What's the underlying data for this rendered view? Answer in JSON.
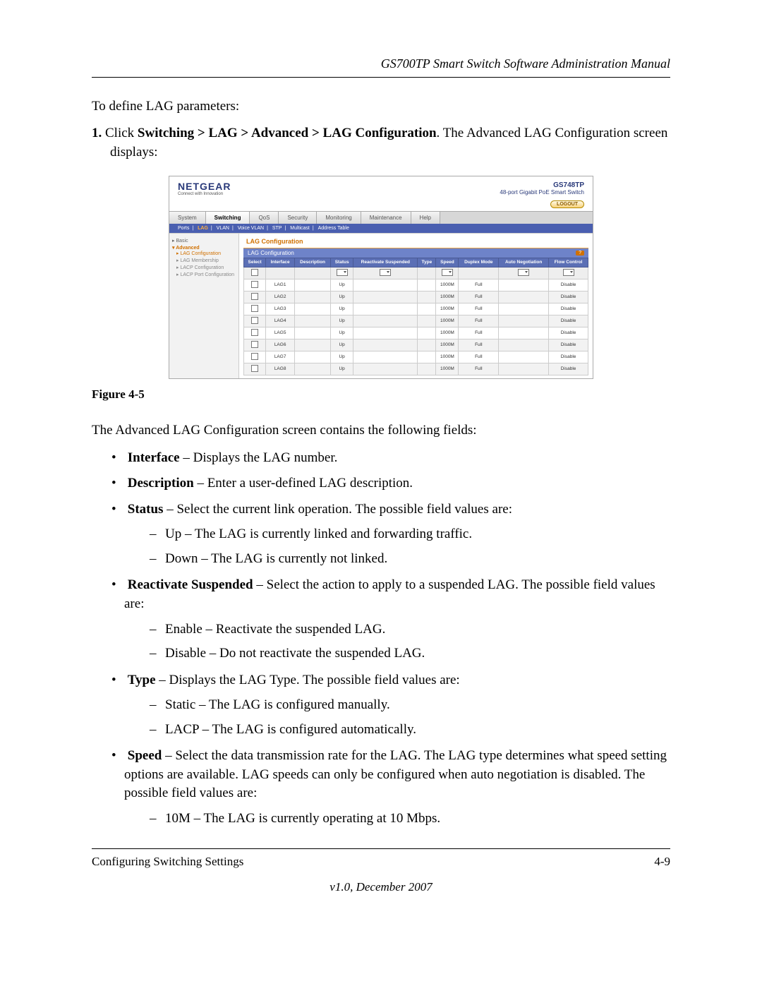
{
  "header_title": "GS700TP Smart Switch Software Administration Manual",
  "intro": "To define LAG parameters:",
  "step": {
    "num": "1.",
    "pre": "Click ",
    "path": "Switching > LAG > Advanced > LAG Configuration",
    "post": ". The Advanced LAG Configuration screen displays:"
  },
  "screenshot": {
    "logo": "NETGEAR",
    "logo_sub": "Connect with Innovation",
    "model_num": "GS748TP",
    "model_desc": "48-port Gigabit PoE Smart Switch",
    "logout": "LOGOUT",
    "tabs": [
      "System",
      "Switching",
      "QoS",
      "Security",
      "Monitoring",
      "Maintenance",
      "Help"
    ],
    "active_tab": "Switching",
    "subtabs": [
      "Ports",
      "LAG",
      "VLAN",
      "Voice VLAN",
      "STP",
      "Multicast",
      "Address Table"
    ],
    "active_subtab": "LAG",
    "side": {
      "basic": "Basic",
      "advanced": "Advanced",
      "items": [
        "LAG Configuration",
        "LAG Membership",
        "LACP Configuration",
        "LACP Port Configuration"
      ]
    },
    "panel_title": "LAG Configuration",
    "inner_title": "LAG Configuration",
    "help": "?",
    "columns": [
      "Select",
      "Interface",
      "Description",
      "Status",
      "Reactivate Suspended",
      "Type",
      "Speed",
      "Duplex Mode",
      "Auto Negotiation",
      "Flow Control"
    ],
    "rows": [
      {
        "if": "LAG1",
        "status": "Up",
        "speed": "1000M",
        "duplex": "Full",
        "flow": "Disable",
        "alt": false
      },
      {
        "if": "LAG2",
        "status": "Up",
        "speed": "1000M",
        "duplex": "Full",
        "flow": "Disable",
        "alt": true
      },
      {
        "if": "LAG3",
        "status": "Up",
        "speed": "1000M",
        "duplex": "Full",
        "flow": "Disable",
        "alt": false
      },
      {
        "if": "LAG4",
        "status": "Up",
        "speed": "1000M",
        "duplex": "Full",
        "flow": "Disable",
        "alt": true
      },
      {
        "if": "LAG5",
        "status": "Up",
        "speed": "1000M",
        "duplex": "Full",
        "flow": "Disable",
        "alt": false
      },
      {
        "if": "LAG6",
        "status": "Up",
        "speed": "1000M",
        "duplex": "Full",
        "flow": "Disable",
        "alt": true
      },
      {
        "if": "LAG7",
        "status": "Up",
        "speed": "1000M",
        "duplex": "Full",
        "flow": "Disable",
        "alt": false
      },
      {
        "if": "LAG8",
        "status": "Up",
        "speed": "1000M",
        "duplex": "Full",
        "flow": "Disable",
        "alt": true
      }
    ]
  },
  "caption": "Figure 4-5",
  "para_fields_intro": "The Advanced LAG Configuration screen contains the following fields:",
  "fields": {
    "interface": {
      "name": "Interface",
      "desc": " – Displays the LAG number."
    },
    "description": {
      "name": "Description",
      "desc": " – Enter a user-defined LAG description."
    },
    "status": {
      "name": "Status",
      "desc": " – Select the current link operation. The possible field values are:",
      "sub": [
        "Up – The LAG is currently linked and forwarding traffic.",
        "Down – The LAG is currently not linked."
      ]
    },
    "reactivate": {
      "name": "Reactivate Suspended",
      "desc": " – Select the action to apply to a suspended LAG. The possible field values are:",
      "sub": [
        "Enable – Reactivate the suspended LAG.",
        "Disable – Do not reactivate the suspended LAG."
      ]
    },
    "type": {
      "name": "Type",
      "desc": " – Displays the LAG Type. The possible field values are:",
      "sub": [
        "Static – The LAG is configured manually.",
        "LACP – The LAG is configured automatically."
      ]
    },
    "speed": {
      "name": "Speed",
      "desc": " – Select the data transmission rate for the LAG. The LAG type determines what speed setting options are available. LAG speeds can only be configured when auto negotiation is disabled. The possible field values are:",
      "sub": [
        "10M – The LAG is currently operating at 10 Mbps."
      ]
    }
  },
  "footer_left": "Configuring Switching Settings",
  "footer_right": "4-9",
  "version": "v1.0, December 2007"
}
